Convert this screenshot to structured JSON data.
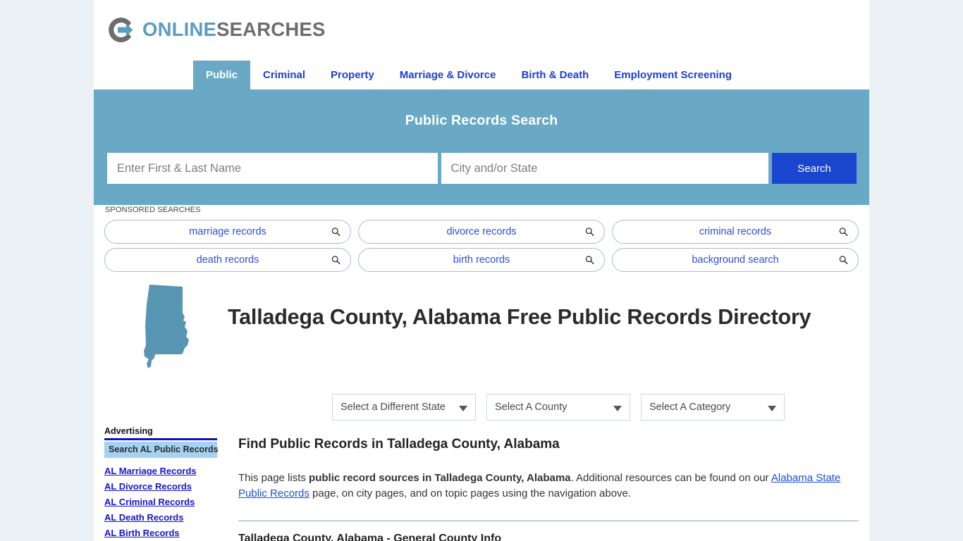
{
  "brand": {
    "name_part1": "ONLINE",
    "name_part2": "SEARCHES",
    "logo_icon": "circle-arrow-logo-icon",
    "color_blue": "#5b9dc0",
    "color_gray": "#6d6d6d"
  },
  "nav": {
    "items": [
      {
        "label": "Public",
        "active": true
      },
      {
        "label": "Criminal",
        "active": false
      },
      {
        "label": "Property",
        "active": false
      },
      {
        "label": "Marriage & Divorce",
        "active": false
      },
      {
        "label": "Birth & Death",
        "active": false
      },
      {
        "label": "Employment Screening",
        "active": false
      }
    ],
    "active_bg": "#69a9c5",
    "link_color": "#1b3fd6"
  },
  "hero": {
    "title": "Public Records Search",
    "background": "#69a9c5",
    "name_placeholder": "Enter First & Last Name",
    "name_value": "",
    "location_placeholder": "City and/or State",
    "location_value": "",
    "search_button": "Search",
    "search_button_color": "#1a45ce"
  },
  "sponsored": {
    "label": "SPONSORED SEARCHES",
    "icon": "magnifier-icon",
    "link_color": "#2b4fd8",
    "items": [
      {
        "label": "marriage records"
      },
      {
        "label": "divorce records"
      },
      {
        "label": "criminal records"
      },
      {
        "label": "death records"
      },
      {
        "label": "birth records"
      },
      {
        "label": "background search"
      }
    ]
  },
  "main": {
    "state_map_icon": "alabama-state-map-icon",
    "state_map_color": "#5795b3",
    "page_title": "Talladega County, Alabama Free Public Records Directory",
    "selects": [
      {
        "name": "state",
        "value": "Select a Different State"
      },
      {
        "name": "county",
        "value": "Select A County"
      },
      {
        "name": "category",
        "value": "Select A Category"
      }
    ],
    "section_heading": "Find Public Records in Talladega County, Alabama",
    "intro": {
      "text_1": "This page lists ",
      "bold_1": "public record sources in Talladega County, Alabama",
      "text_2": ". Additional resources can be found on our ",
      "link_1": "Alabama State Public Records",
      "text_3": " page, on city pages, and on topic pages using the navigation above."
    },
    "next_heading": "Talladega County, Alabama - General County Info"
  },
  "sidebar": {
    "heading": "Advertising",
    "heading_underline_color": "#1111bb",
    "bar_label": "Search AL Public Records",
    "bar_color": "#a5d2f2",
    "links": [
      {
        "label": "AL Marriage Records"
      },
      {
        "label": "AL Divorce Records"
      },
      {
        "label": "AL Criminal Records"
      },
      {
        "label": "AL Death Records"
      },
      {
        "label": "AL Birth Records"
      }
    ],
    "link_color": "#1616cc"
  },
  "page": {
    "background": "#ebf1f5",
    "container_background": "#ffffff"
  }
}
